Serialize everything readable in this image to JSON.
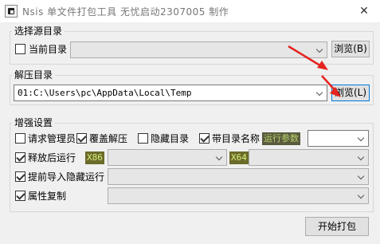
{
  "window": {
    "title": "Nsis 单文件打包工具 无忧启动2307005 制作",
    "close_glyph": "✕",
    "icon": "app-icon"
  },
  "source_group": {
    "title": "选择源目录",
    "current_dir_label": "当前目录",
    "current_dir_checked": false,
    "path_value": "",
    "browse_label": "浏览(B)"
  },
  "extract_group": {
    "title": "解压目录",
    "path_value": "01:C:\\Users\\pc\\AppData\\Local\\Temp",
    "browse_label": "浏览(L)"
  },
  "enhance_group": {
    "title": "增强设置",
    "request_admin": {
      "label": "请求管理员",
      "checked": false
    },
    "overwrite_extract": {
      "label": "覆盖解压",
      "checked": true
    },
    "hide_dir": {
      "label": "隐藏目录",
      "checked": false
    },
    "with_dir_name": {
      "label": "带目录名称",
      "checked": true
    },
    "run_params_tag": "运行参数",
    "run_params_value": "",
    "run_after_release": {
      "label": "释放后运行",
      "checked": true
    },
    "x86_tag": "X86",
    "x86_value": "",
    "x64_tag": "X64",
    "x64_value": "",
    "pre_import_hidden_run": {
      "label": "提前导入隐藏运行",
      "checked": true
    },
    "pre_import_value": "",
    "copy_attributes": {
      "label": "属性复制",
      "checked": true
    },
    "copy_attributes_value": ""
  },
  "footer": {
    "start_pack_label": "开始打包"
  },
  "colors": {
    "annotation_arrow": "#e52420",
    "tag_bg": "#5a5a3f",
    "tag_text": "#b8d36b"
  }
}
